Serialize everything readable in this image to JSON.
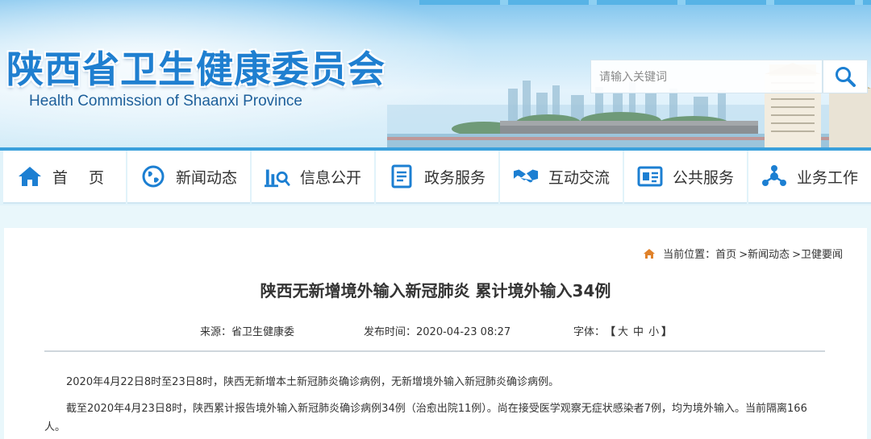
{
  "site": {
    "title": "陕西省卫生健康委员会",
    "subtitle": "Health Commission of Shaanxi Province"
  },
  "search": {
    "placeholder": "请输入关键词",
    "icon": "search-icon"
  },
  "nav": {
    "items": [
      {
        "label": "首 页",
        "icon": "home-icon"
      },
      {
        "label": "新闻动态",
        "icon": "globe-icon"
      },
      {
        "label": "信息公开",
        "icon": "chart-search-icon"
      },
      {
        "label": "政务服务",
        "icon": "document-icon"
      },
      {
        "label": "互动交流",
        "icon": "handshake-icon"
      },
      {
        "label": "公共服务",
        "icon": "id-card-icon"
      },
      {
        "label": "业务工作",
        "icon": "network-icon"
      }
    ]
  },
  "breadcrumb": {
    "prefix": "当前位置：",
    "items": [
      "首页",
      ">新闻动态",
      ">卫健要闻"
    ]
  },
  "article": {
    "title": "陕西无新增境外输入新冠肺炎 累计境外输入34例",
    "source": "来源：省卫生健康委",
    "publish_time": "发布时间：2020-04-23 08:27",
    "font_label": "字体：",
    "font_open": "【",
    "font_large": "大",
    "font_medium": "中",
    "font_small": "小",
    "font_close": "】",
    "paragraphs": [
      "2020年4月22日8时至23日8时，陕西无新增本土新冠肺炎确诊病例，无新增境外输入新冠肺炎确诊病例。",
      "截至2020年4月23日8时，陕西累计报告境外输入新冠肺炎确诊病例34例（治愈出院11例）。尚在接受医学观察无症状感染者7例，均为境外输入。当前隔离166人。"
    ]
  },
  "colors": {
    "brand": "#1f7fd0",
    "nav_icon": "#1c7fd2",
    "breadcrumb_icon": "#e0822a"
  }
}
